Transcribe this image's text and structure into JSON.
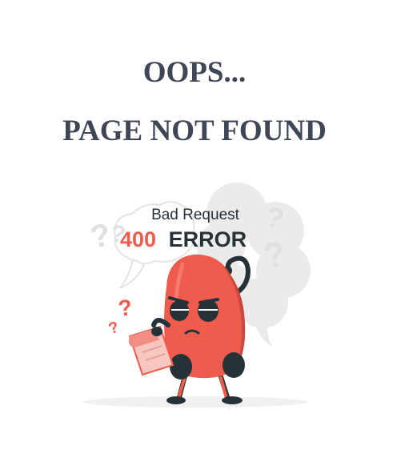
{
  "page": {
    "heading_line1": "OOPS...",
    "heading_line2": "PAGE NOT FOUND"
  },
  "illustration": {
    "subtitle": "Bad Request",
    "error_code": "400",
    "error_word": "ERROR",
    "colors": {
      "heading": "#3f4656",
      "accent": "#ef5b4c",
      "dark": "#263238",
      "bubble": "#ebebeb"
    },
    "icons": [
      "thought-bubble-icon",
      "question-mark-icon",
      "error-mascot-figure",
      "paper-note-icon"
    ]
  }
}
